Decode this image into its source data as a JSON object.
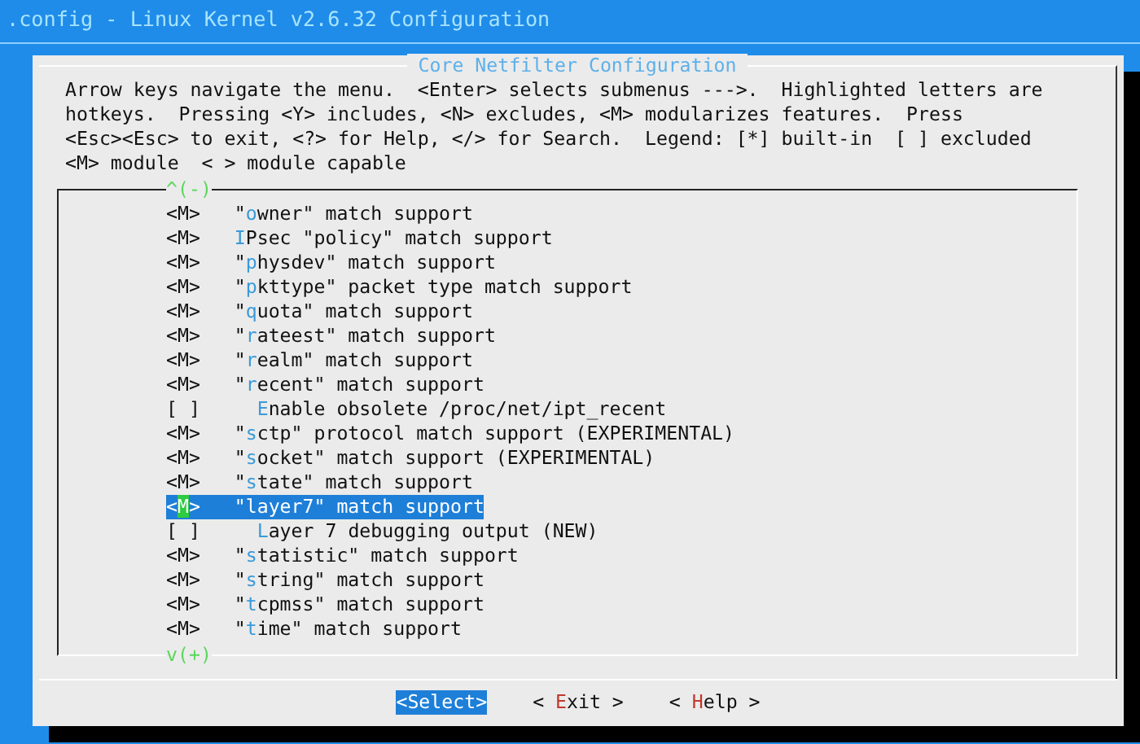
{
  "window": {
    "title": ".config - Linux Kernel v2.6.32 Configuration"
  },
  "dialog": {
    "title": "Core Netfilter Configuration",
    "help_lines": [
      "Arrow keys navigate the menu.  <Enter> selects submenus --->.  Highlighted letters are",
      "hotkeys.  Pressing <Y> includes, <N> excludes, <M> modularizes features.  Press",
      "<Esc><Esc> to exit, <?> for Help, </> for Search.  Legend: [*] built-in  [ ] excluded",
      "<M> module  < > module capable"
    ]
  },
  "menu": {
    "scroll_up": "^(-)",
    "scroll_down": "v(+)",
    "items": [
      {
        "status": "<M>",
        "before": "\"",
        "hotkey": "o",
        "after": "wner\" match support",
        "selected": false
      },
      {
        "status": "<M>",
        "hotkey": "I",
        "after": "Psec \"policy\" match support",
        "selected": false
      },
      {
        "status": "<M>",
        "before": "\"",
        "hotkey": "p",
        "after": "hysdev\" match support",
        "selected": false
      },
      {
        "status": "<M>",
        "before": "\"",
        "hotkey": "p",
        "after": "kttype\" packet type match support",
        "selected": false
      },
      {
        "status": "<M>",
        "before": "\"",
        "hotkey": "q",
        "after": "uota\" match support",
        "selected": false
      },
      {
        "status": "<M>",
        "before": "\"",
        "hotkey": "r",
        "after": "ateest\" match support",
        "selected": false
      },
      {
        "status": "<M>",
        "before": "\"",
        "hotkey": "r",
        "after": "ealm\" match support",
        "selected": false
      },
      {
        "status": "<M>",
        "before": "\"",
        "hotkey": "r",
        "after": "ecent\" match support",
        "selected": false,
        "children": [
          {
            "status": "[ ]",
            "hotkey": "E",
            "after": "nable obsolete /proc/net/ipt_recent",
            "selected": false
          }
        ]
      },
      {
        "status": "<M>",
        "before": "\"",
        "hotkey": "s",
        "after": "ctp\" protocol match support (EXPERIMENTAL)",
        "selected": false
      },
      {
        "status": "<M>",
        "before": "\"",
        "hotkey": "s",
        "after": "ocket\" match support (EXPERIMENTAL)",
        "selected": false
      },
      {
        "status": "<M>",
        "before": "\"",
        "hotkey": "s",
        "after": "tate\" match support",
        "selected": false
      },
      {
        "status": "<M>",
        "before": "\"",
        "hotkey": "l",
        "after": "ayer7\" match support",
        "selected": true,
        "children": [
          {
            "status": "[ ]",
            "hotkey": "L",
            "after": "ayer 7 debugging output (NEW)",
            "selected": false
          }
        ]
      },
      {
        "status": "<M>",
        "before": "\"",
        "hotkey": "s",
        "after": "tatistic\" match support",
        "selected": false
      },
      {
        "status": "<M>",
        "before": "\"",
        "hotkey": "s",
        "after": "tring\" match support",
        "selected": false
      },
      {
        "status": "<M>",
        "before": "\"",
        "hotkey": "t",
        "after": "cpmss\" match support",
        "selected": false
      },
      {
        "status": "<M>",
        "before": "\"",
        "hotkey": "t",
        "after": "ime\" match support",
        "selected": false
      }
    ]
  },
  "buttons": [
    {
      "before": "<",
      "hotkey": "S",
      "after": "elect>",
      "selected": true
    },
    {
      "before": "< ",
      "hotkey": "E",
      "after": "xit >",
      "selected": false
    },
    {
      "before": "< ",
      "hotkey": "H",
      "after": "elp >",
      "selected": false
    }
  ]
}
